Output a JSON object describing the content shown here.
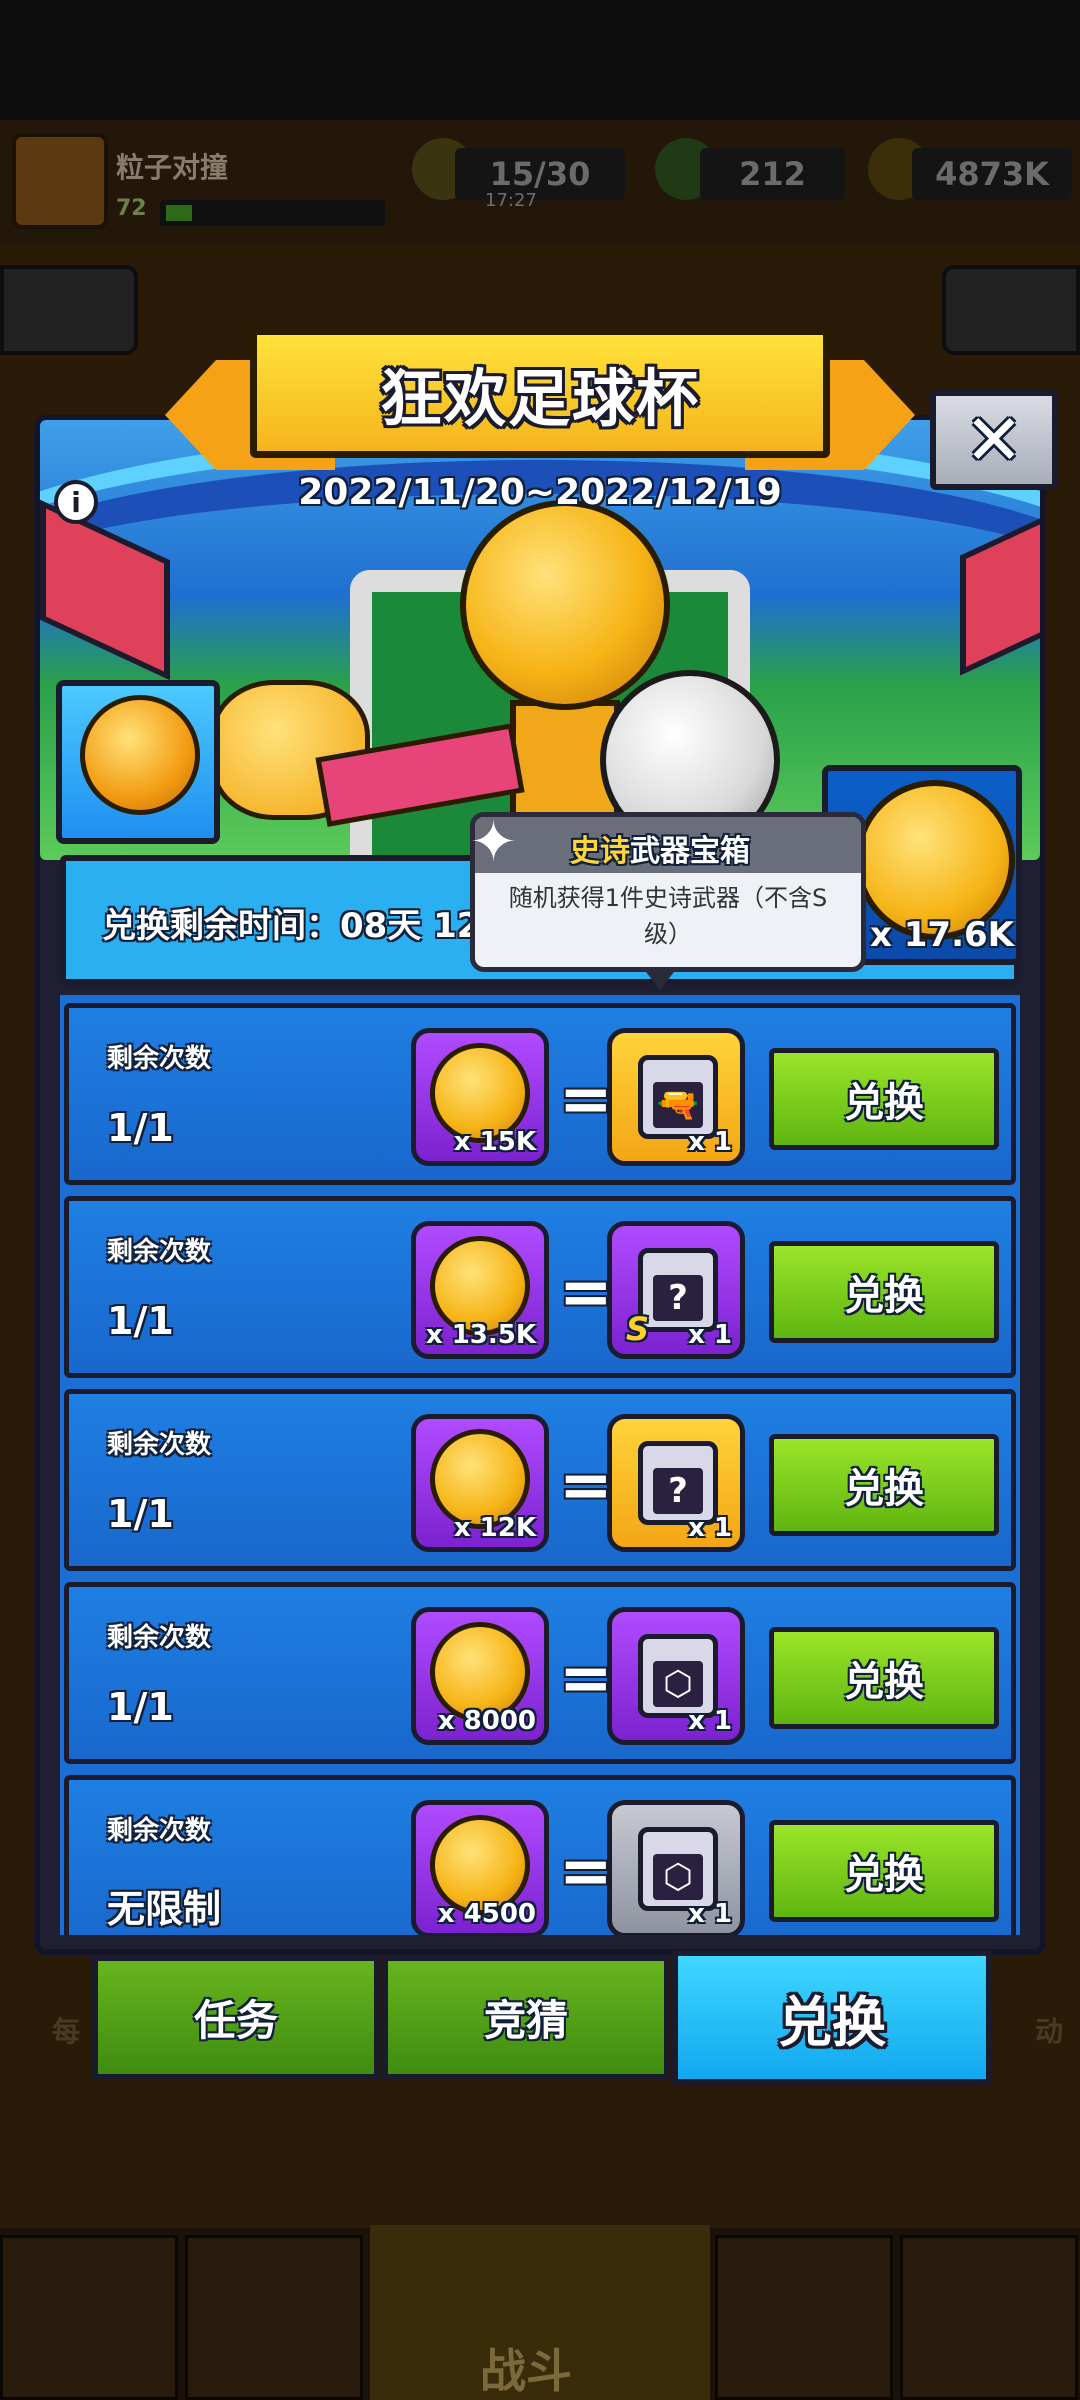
{
  "hud": {
    "player_name": "粒子对撞",
    "player_level": "72",
    "energy": "15/30",
    "energy_timer": "17:27",
    "gems": "212",
    "gold": "4873K"
  },
  "event": {
    "title": "狂欢足球杯",
    "date_range": "2022/11/20~2022/12/19",
    "info_icon": "i",
    "close_icon": "✕",
    "currency_amount": "x 17.6K",
    "time_remaining": "兑换剩余时间：08天 12"
  },
  "tooltip": {
    "title_highlight": "史诗",
    "title_rest": "武器宝箱",
    "description": "随机获得1件史诗武器（不含S级）"
  },
  "rows": [
    {
      "label": "剩余次数",
      "count": "1/1",
      "cost": "x 15K",
      "reward_qty": "x 1",
      "reward_style": "gold",
      "reward_glyph": "🔫",
      "badge": "",
      "button": "兑换"
    },
    {
      "label": "剩余次数",
      "count": "1/1",
      "cost": "x 13.5K",
      "reward_qty": "x 1",
      "reward_style": "purple",
      "reward_glyph": "?",
      "badge": "S",
      "button": "兑换"
    },
    {
      "label": "剩余次数",
      "count": "1/1",
      "cost": "x 12K",
      "reward_qty": "x 1",
      "reward_style": "gold",
      "reward_glyph": "?",
      "badge": "",
      "button": "兑换"
    },
    {
      "label": "剩余次数",
      "count": "1/1",
      "cost": "x 8000",
      "reward_qty": "x 1",
      "reward_style": "purple",
      "reward_glyph": "⬡",
      "badge": "",
      "button": "兑换"
    },
    {
      "label": "剩余次数",
      "count": "无限制",
      "cost": "x 4500",
      "reward_qty": "x 1",
      "reward_style": "gray",
      "reward_glyph": "⬡",
      "badge": "",
      "button": "兑换"
    }
  ],
  "tabs": {
    "task": "任务",
    "guess": "竞猜",
    "exchange": "兑换"
  },
  "nav": {
    "battle": "战斗",
    "left_partial": "每",
    "right_partial": "动"
  },
  "colors": {
    "accent_blue": "#1f7fe2",
    "button_green": "#7ccb1c",
    "title_yellow": "#ffe23a",
    "purple_slot": "#9a36e8"
  }
}
